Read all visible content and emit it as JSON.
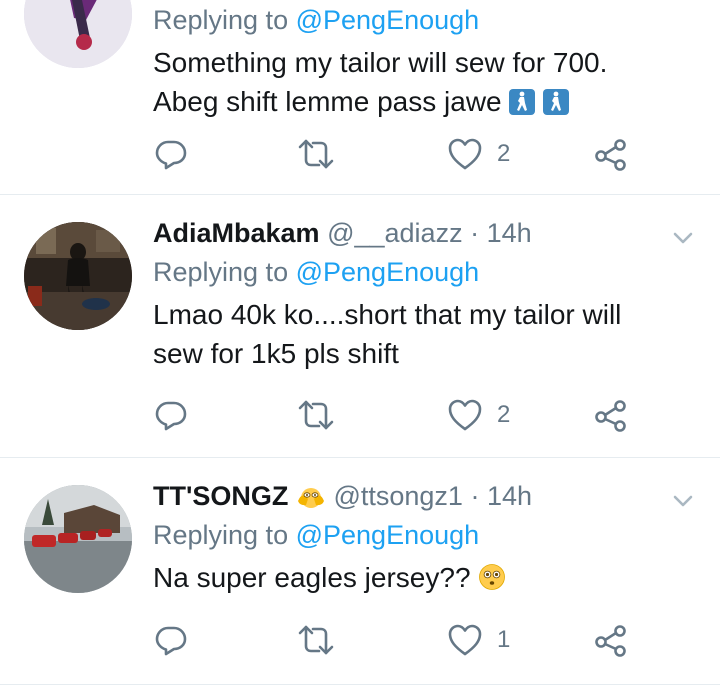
{
  "tweets": [
    {
      "display_name": "",
      "handle": "",
      "time": "",
      "replying_prefix": "Replying to",
      "replying_mention": "@PengEnough",
      "lines": [
        "Something my tailor will sew for 700.",
        "Abeg shift lemme pass jawe"
      ],
      "emoji_icons": [
        "pedestrian-emoji",
        "pedestrian-emoji"
      ],
      "like_count": "2"
    },
    {
      "display_name": "AdiaMbakam",
      "handle": "@__adiazz",
      "separator": "·",
      "time": "14h",
      "replying_prefix": "Replying to",
      "replying_mention": "@PengEnough",
      "lines": [
        "Lmao 40k ko....short that my tailor will",
        "sew for 1k5 pls shift"
      ],
      "like_count": "2"
    },
    {
      "display_name": "TT'SONGZ",
      "name_emoji": "hiding-face-emoji",
      "handle": "@ttsongz1",
      "separator": "·",
      "time": "14h",
      "replying_prefix": "Replying to",
      "replying_mention": "@PengEnough",
      "lines": [
        "Na super eagles jersey??"
      ],
      "text_emoji": "flushed-face-emoji",
      "like_count": "1"
    }
  ],
  "icons": {
    "reply": "reply-icon",
    "retweet": "retweet-icon",
    "like": "heart-icon",
    "share": "share-icon",
    "caret": "chevron-down-icon"
  },
  "colors": {
    "text": "#14171a",
    "secondary": "#657786",
    "mention": "#1da1f2",
    "divider": "#e6ecf0"
  }
}
